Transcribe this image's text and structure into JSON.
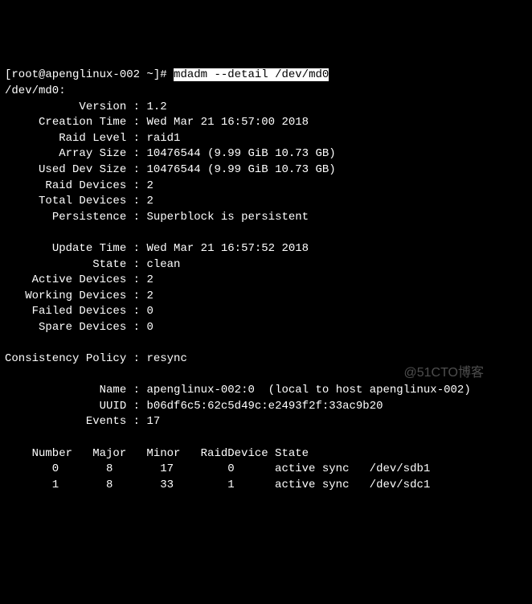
{
  "prompt": {
    "user_host": "[root@apenglinux-002 ~]# ",
    "command": "mdadm --detail /dev/md0"
  },
  "device_path": "/dev/md0:",
  "details": {
    "version": {
      "label": "Version",
      "value": "1.2"
    },
    "creation_time": {
      "label": "Creation Time",
      "value": "Wed Mar 21 16:57:00 2018"
    },
    "raid_level": {
      "label": "Raid Level",
      "value": "raid1"
    },
    "array_size": {
      "label": "Array Size",
      "value": "10476544 (9.99 GiB 10.73 GB)"
    },
    "used_dev_size": {
      "label": "Used Dev Size",
      "value": "10476544 (9.99 GiB 10.73 GB)"
    },
    "raid_devices": {
      "label": "Raid Devices",
      "value": "2"
    },
    "total_devices": {
      "label": "Total Devices",
      "value": "2"
    },
    "persistence": {
      "label": "Persistence",
      "value": "Superblock is persistent"
    },
    "update_time": {
      "label": "Update Time",
      "value": "Wed Mar 21 16:57:52 2018"
    },
    "state": {
      "label": "State",
      "value": "clean"
    },
    "active_devices": {
      "label": "Active Devices",
      "value": "2"
    },
    "working_devices": {
      "label": "Working Devices",
      "value": "2"
    },
    "failed_devices": {
      "label": "Failed Devices",
      "value": "0"
    },
    "spare_devices": {
      "label": "Spare Devices",
      "value": "0"
    },
    "consistency_policy": {
      "label": "Consistency Policy",
      "value": "resync"
    },
    "name": {
      "label": "Name",
      "value": "apenglinux-002:0  (local to host apenglinux-002)"
    },
    "uuid": {
      "label": "UUID",
      "value": "b06df6c5:62c5d49c:e2493f2f:33ac9b20"
    },
    "events": {
      "label": "Events",
      "value": "17"
    }
  },
  "table": {
    "header": "    Number   Major   Minor   RaidDevice State",
    "rows": [
      "       0       8       17        0      active sync   /dev/sdb1",
      "       1       8       33        1      active sync   /dev/sdc1"
    ]
  },
  "watermark": "@51CTO博客"
}
